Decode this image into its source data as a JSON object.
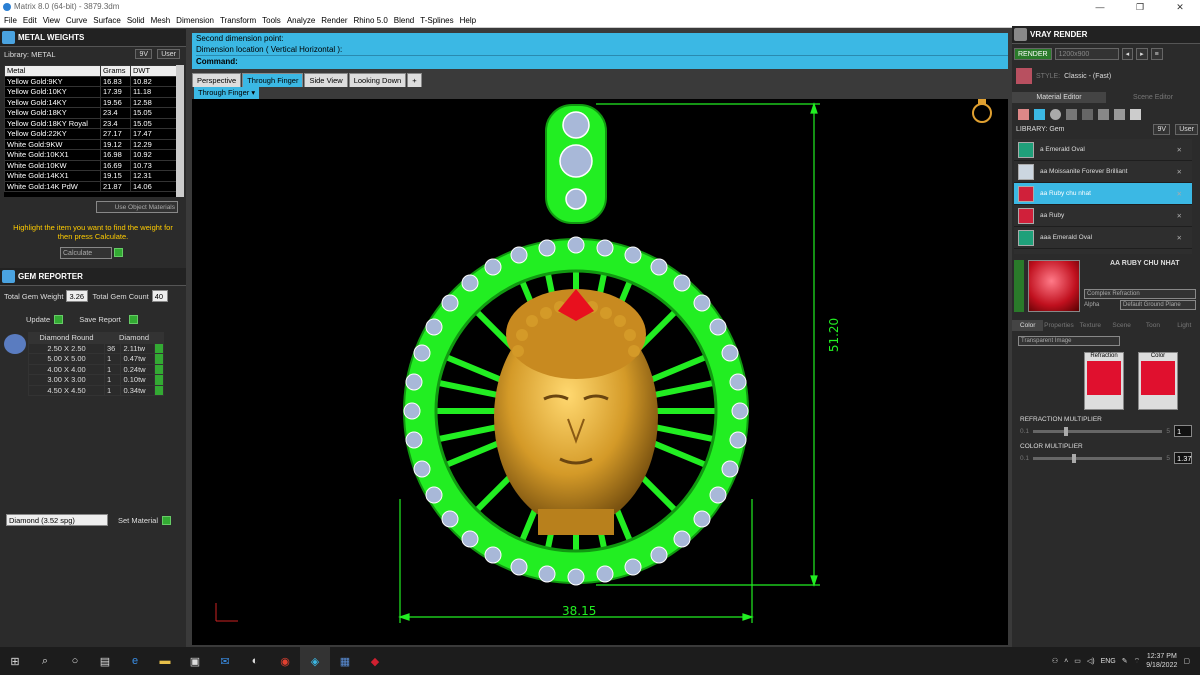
{
  "window": {
    "title": "Matrix 8.0 (64-bit) - 3879.3dm",
    "minimize": "—",
    "maximize": "❐",
    "close": "✕"
  },
  "menu": [
    "File",
    "Edit",
    "View",
    "Curve",
    "Surface",
    "Solid",
    "Mesh",
    "Dimension",
    "Transform",
    "Tools",
    "Analyze",
    "Render",
    "Rhino 5.0",
    "Blend",
    "T-Splines",
    "Help"
  ],
  "metal": {
    "header": "METAL WEIGHTS",
    "library_label": "Library: METAL",
    "lib_btns": [
      "9V",
      "User"
    ],
    "columns": [
      "Metal",
      "Grams",
      "DWT"
    ],
    "rows": [
      [
        "Yellow Gold:9KY",
        "16.83",
        "10.82"
      ],
      [
        "Yellow Gold:10KY",
        "17.39",
        "11.18"
      ],
      [
        "Yellow Gold:14KY",
        "19.56",
        "12.58"
      ],
      [
        "Yellow Gold:18KY",
        "23.4",
        "15.05"
      ],
      [
        "Yellow Gold:18KY Royal",
        "23.4",
        "15.05"
      ],
      [
        "Yellow Gold:22KY",
        "27.17",
        "17.47"
      ],
      [
        "White Gold:9KW",
        "19.12",
        "12.29"
      ],
      [
        "White Gold:10KX1",
        "16.98",
        "10.92"
      ],
      [
        "White Gold:10KW",
        "16.69",
        "10.73"
      ],
      [
        "White Gold:14KX1",
        "19.15",
        "12.31"
      ],
      [
        "White Gold:14K PdW",
        "21.87",
        "14.06"
      ]
    ],
    "use_object_materials": "Use Object Materials",
    "hint": "Highlight the item you want to find the weight for then press Calculate.",
    "calculate": "Calculate"
  },
  "gem": {
    "header": "GEM REPORTER",
    "total_weight_label": "Total Gem Weight",
    "total_weight": "3.26",
    "total_count_label": "Total Gem Count",
    "total_count": "40",
    "update": "Update",
    "save_report": "Save Report",
    "columns": [
      "Diamond Round",
      "Diamond"
    ],
    "rows": [
      [
        "2.50 X 2.50",
        "36",
        "2.11tw"
      ],
      [
        "5.00 X 5.00",
        "1",
        "0.47tw"
      ],
      [
        "4.00 X 4.00",
        "1",
        "0.24tw"
      ],
      [
        "3.00 X 3.00",
        "1",
        "0.10tw"
      ],
      [
        "4.50 X 4.50",
        "1",
        "0.34tw"
      ]
    ],
    "material_select": "Diamond    (3.52 spg)",
    "set_material": "Set Material"
  },
  "command": {
    "line1": "Second dimension point:",
    "line2": "Dimension location ( Vertical  Horizontal ):",
    "prompt": "Command:"
  },
  "viewtabs": [
    "Perspective",
    "Through Finger",
    "Side View",
    "Looking Down",
    "+"
  ],
  "active_subtab": "Through Finger",
  "dims": {
    "height": "51.20",
    "width": "38.15"
  },
  "vray": {
    "header": "VRAY RENDER",
    "render": "RENDER",
    "resolution": "1200x900",
    "style_label": "STYLE:",
    "style": "Classic - (Fast)",
    "tabs": [
      "Material Editor",
      "Scene Editor"
    ],
    "library_label": "LIBRARY: Gem",
    "lib_btns": [
      "9V",
      "User"
    ],
    "materials": [
      {
        "name": "a Emerald Oval",
        "color": "#1fa07a"
      },
      {
        "name": "aa Moissanite Forever Brilliant",
        "color": "#ccd6e0"
      },
      {
        "name": "aa Ruby chu nhat",
        "color": "#d0203a"
      },
      {
        "name": "aa Ruby",
        "color": "#d0203a"
      },
      {
        "name": "aaa Emerald Oval",
        "color": "#1fa07a"
      }
    ],
    "selected_name": "AA RUBY CHU NHAT",
    "refraction_mode": "Complex Refraction",
    "alpha_label": "Alpha",
    "ground": "Default Ground Plane",
    "prop_tabs": [
      "Color",
      "Properties",
      "Texture",
      "Scene",
      "Toon",
      "Light"
    ],
    "transparent": "Transparent Image",
    "refraction": "Refraction",
    "color": "Color",
    "ref_mult_label": "REFRACTION MULTIPLIER",
    "ref_min": "0.1",
    "ref_max": "5",
    "ref_val": "1",
    "color_mult_label": "COLOR MULTIPLIER",
    "col_min": "0.1",
    "col_max": "5",
    "col_val": "1.37"
  },
  "tray": {
    "lang": "ENG",
    "time": "12:37 PM",
    "date": "9/18/2022"
  },
  "colors": {
    "accent": "#3bb8e4",
    "green": "#22ee22",
    "gold": "#e0a830"
  }
}
